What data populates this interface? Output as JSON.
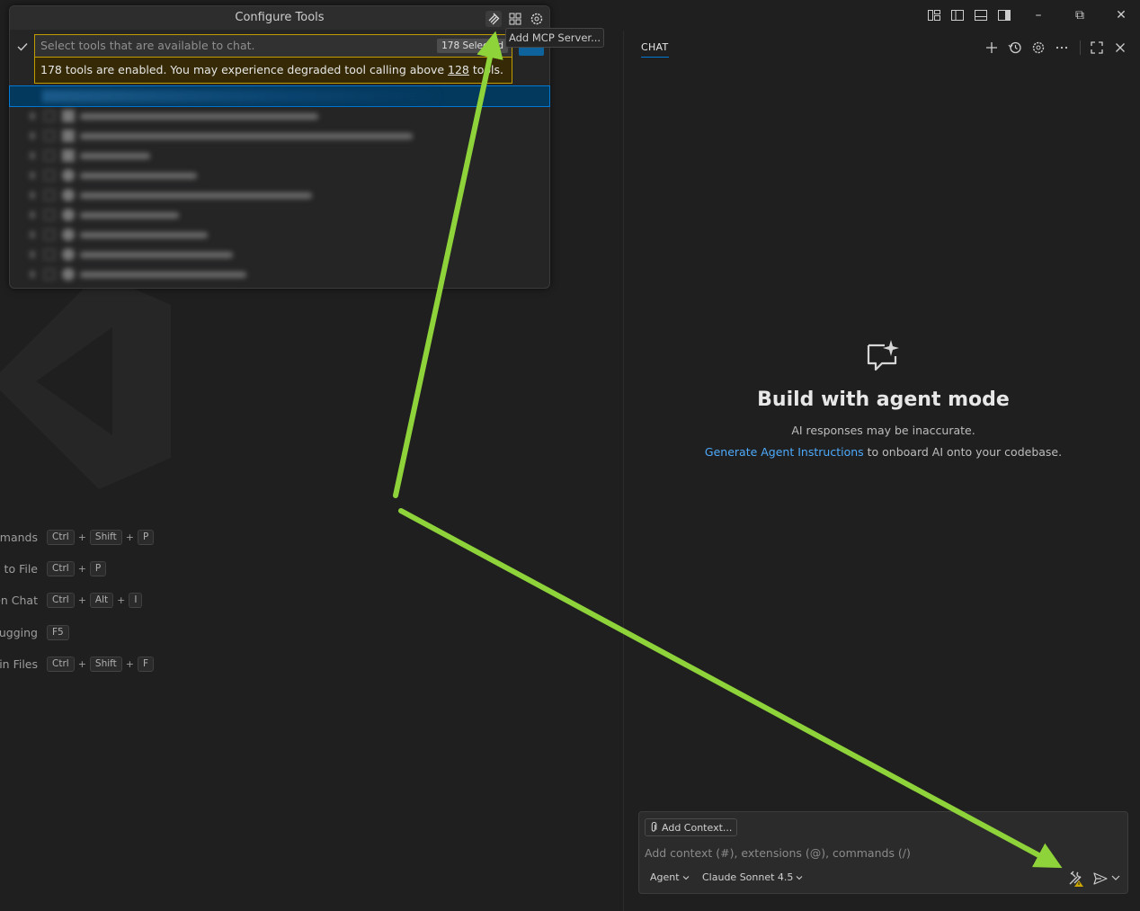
{
  "quickpick": {
    "title": "Configure Tools",
    "placeholder": "Select tools that are available to chat.",
    "selected_count": "178 Selected",
    "warning_prefix": "178 tools are enabled. You may experience degraded tool calling above ",
    "warning_link": "128",
    "warning_suffix": " tools.",
    "tooltip": "Add MCP Server...",
    "actions": [
      "add-mcp-server-icon",
      "extensions-icon",
      "gear-icon"
    ]
  },
  "editor": {
    "shortcuts": [
      {
        "label": "mmands",
        "keys": [
          "Ctrl",
          "Shift",
          "P"
        ]
      },
      {
        "label": "o to File",
        "keys": [
          "Ctrl",
          "P"
        ]
      },
      {
        "label": "pen Chat",
        "keys": [
          "Ctrl",
          "Alt",
          "I"
        ]
      },
      {
        "label": "bugging",
        "keys": [
          "F5"
        ]
      },
      {
        "label": "l in Files",
        "keys": [
          "Ctrl",
          "Shift",
          "F"
        ]
      }
    ]
  },
  "chat": {
    "tab": "CHAT",
    "title": "Build with agent mode",
    "subtitle": "AI responses may be inaccurate.",
    "link": "Generate Agent Instructions",
    "link_suffix": " to onboard AI onto your codebase.",
    "add_context": "Add Context...",
    "input_placeholder": "Add context (#), extensions (@), commands (/)",
    "mode": "Agent",
    "model": "Claude Sonnet 4.5"
  },
  "colors": {
    "accent": "#0078d4",
    "link": "#4daafc",
    "warning_border": "#c19c00",
    "annotation_arrow": "#8fd33a"
  }
}
